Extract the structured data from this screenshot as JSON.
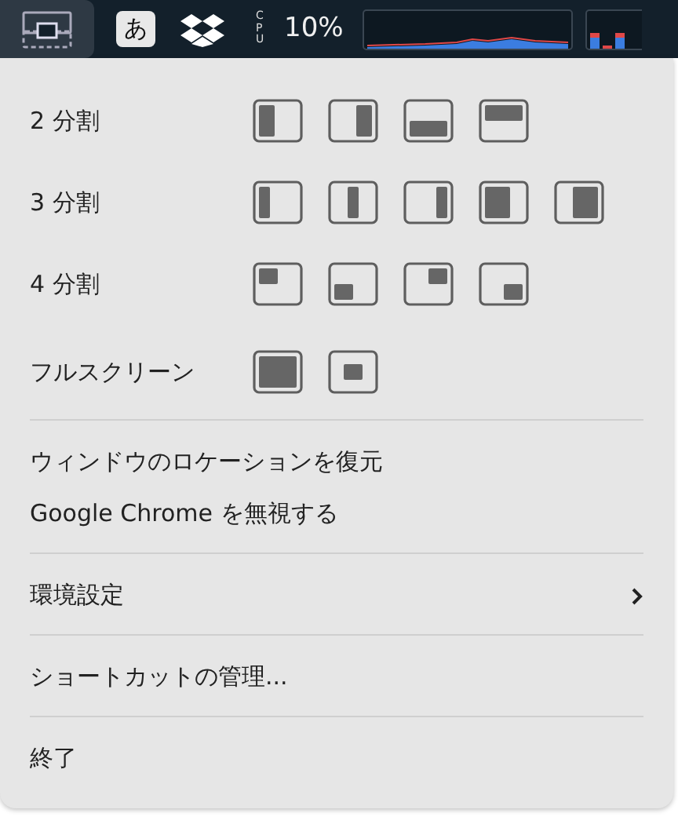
{
  "menu_bar": {
    "input_method": "あ",
    "cpu_label": "CPU",
    "cpu_reading": "10%"
  },
  "layout_rows": [
    {
      "label": "2 分割"
    },
    {
      "label": "3 分割"
    },
    {
      "label": "4 分割"
    },
    {
      "label": "フルスクリーン"
    }
  ],
  "menu_groups": [
    [
      {
        "label": "ウィンドウのロケーションを復元",
        "submenu": false
      },
      {
        "label": "Google Chrome を無視する",
        "submenu": false
      }
    ],
    [
      {
        "label": "環境設定",
        "submenu": true
      }
    ],
    [
      {
        "label": "ショートカットの管理...",
        "submenu": false
      }
    ],
    [
      {
        "label": "終了",
        "submenu": false
      }
    ]
  ]
}
